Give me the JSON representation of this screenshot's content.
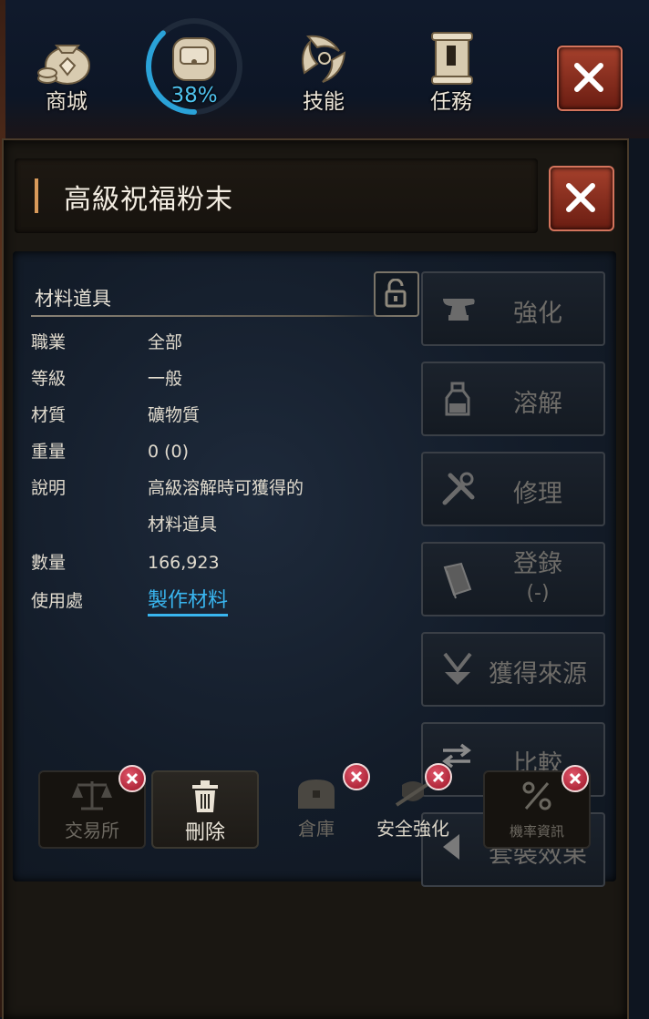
{
  "topbar": {
    "items": [
      {
        "label": "商城",
        "icon": "money-bag-icon"
      },
      {
        "label": "38%",
        "icon": "backpack-icon",
        "progress": 0.38
      },
      {
        "label": "技能",
        "icon": "skill-icon"
      },
      {
        "label": "任務",
        "icon": "scroll-icon"
      }
    ],
    "close_icon": "close-icon"
  },
  "item": {
    "title": "高級祝福粉末",
    "category": "材料道具",
    "lock_icon": "unlock-icon",
    "fields": [
      {
        "key": "職業",
        "value": "全部"
      },
      {
        "key": "等級",
        "value": "一般"
      },
      {
        "key": "材質",
        "value": "礦物質"
      },
      {
        "key": "重量",
        "value": "0 (0)"
      },
      {
        "key": "說明",
        "value": "高級溶解時可獲得的",
        "value2": "材料道具"
      },
      {
        "key": "數量",
        "value": "166,923"
      },
      {
        "key": "使用處",
        "value": "製作材料"
      }
    ]
  },
  "actions": [
    {
      "label": "強化",
      "icon": "anvil-icon"
    },
    {
      "label": "溶解",
      "icon": "potion-bottle-icon"
    },
    {
      "label": "修理",
      "icon": "repair-tools-icon"
    },
    {
      "label": "登錄",
      "sub": "(-)",
      "icon": "book-icon"
    },
    {
      "label": "獲得來源",
      "icon": "source-arrow-icon"
    },
    {
      "label": "比較",
      "icon": "swap-arrows-icon"
    },
    {
      "label": "套裝效果",
      "icon": "triangle-left-icon"
    }
  ],
  "bottom": [
    {
      "label": "交易所",
      "icon": "scales-icon",
      "enabled": false
    },
    {
      "label": "刪除",
      "icon": "trash-icon",
      "enabled": true
    },
    {
      "label": "倉庫",
      "icon": "chest-icon",
      "enabled": false
    },
    {
      "label": "安全強化",
      "icon": "shield-icon",
      "enabled": false
    },
    {
      "label": "機率資訊",
      "icon": "percent-icon",
      "enabled": false
    }
  ],
  "colors": {
    "accent_blue": "#39b6f0",
    "close_red": "#a5402c",
    "badge_red": "#c0293c"
  }
}
